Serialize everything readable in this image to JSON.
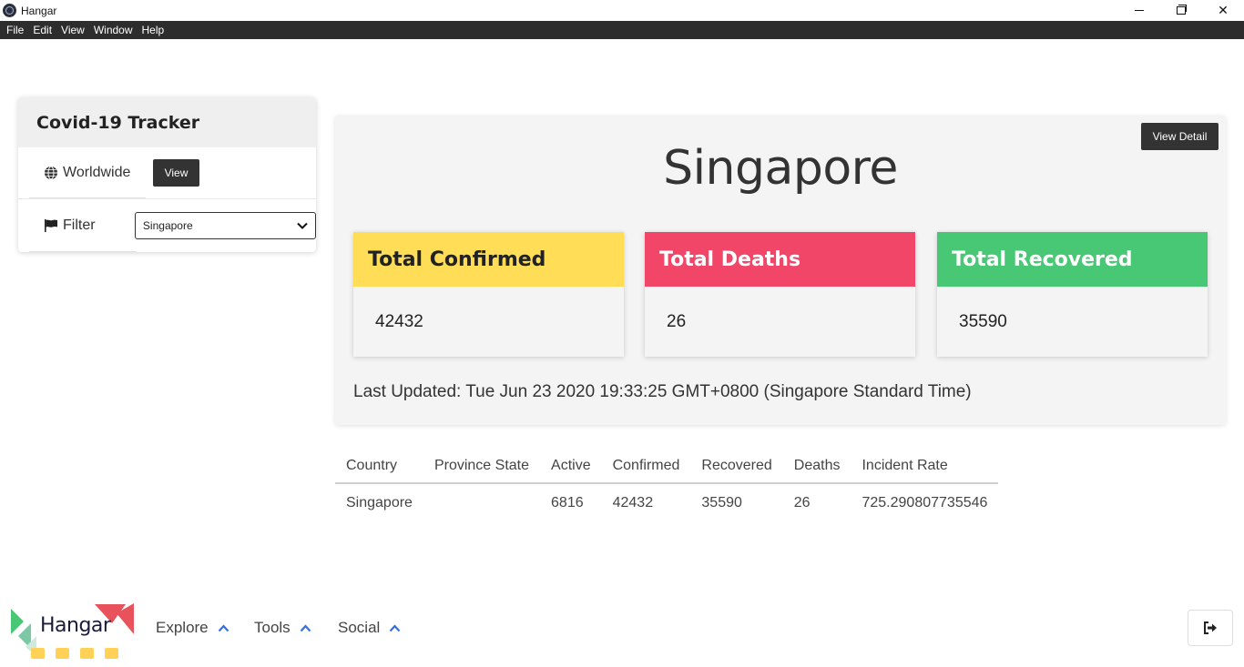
{
  "window": {
    "title": "Hangar",
    "controls": {
      "minimize": "minimize",
      "restore": "restore",
      "close": "✕"
    }
  },
  "menubar": {
    "items": [
      "File",
      "Edit",
      "View",
      "Window",
      "Help"
    ]
  },
  "sidebar": {
    "title": "Covid-19 Tracker",
    "worldwide_label": "Worldwide",
    "worldwide_button": "View",
    "filter_label": "Filter",
    "filter_selected": "Singapore"
  },
  "main": {
    "detail_button": "View Detail",
    "country": "Singapore",
    "cards": {
      "confirmed": {
        "label": "Total Confirmed",
        "value": "42432",
        "color": "#ffdd57"
      },
      "deaths": {
        "label": "Total Deaths",
        "value": "26",
        "color": "#f14668"
      },
      "recovered": {
        "label": "Total Recovered",
        "value": "35590",
        "color": "#48c774"
      }
    },
    "last_updated": "Last Updated: Tue Jun 23 2020 19:33:25 GMT+0800 (Singapore Standard Time)"
  },
  "table": {
    "headers": [
      "Country",
      "Province State",
      "Active",
      "Confirmed",
      "Recovered",
      "Deaths",
      "Incident Rate"
    ],
    "rows": [
      [
        "Singapore",
        "",
        "6816",
        "42432",
        "35590",
        "26",
        "725.290807735546"
      ]
    ]
  },
  "footer": {
    "logo_text": "Hangar",
    "nav": [
      "Explore",
      "Tools",
      "Social"
    ],
    "accent_color": "#3b6fd8"
  },
  "icons": {
    "worldwide": "globe-icon",
    "filter": "flag-icon",
    "select": "chevron-down-icon",
    "nav": "chevron-up-icon",
    "logout": "sign-out-icon"
  }
}
